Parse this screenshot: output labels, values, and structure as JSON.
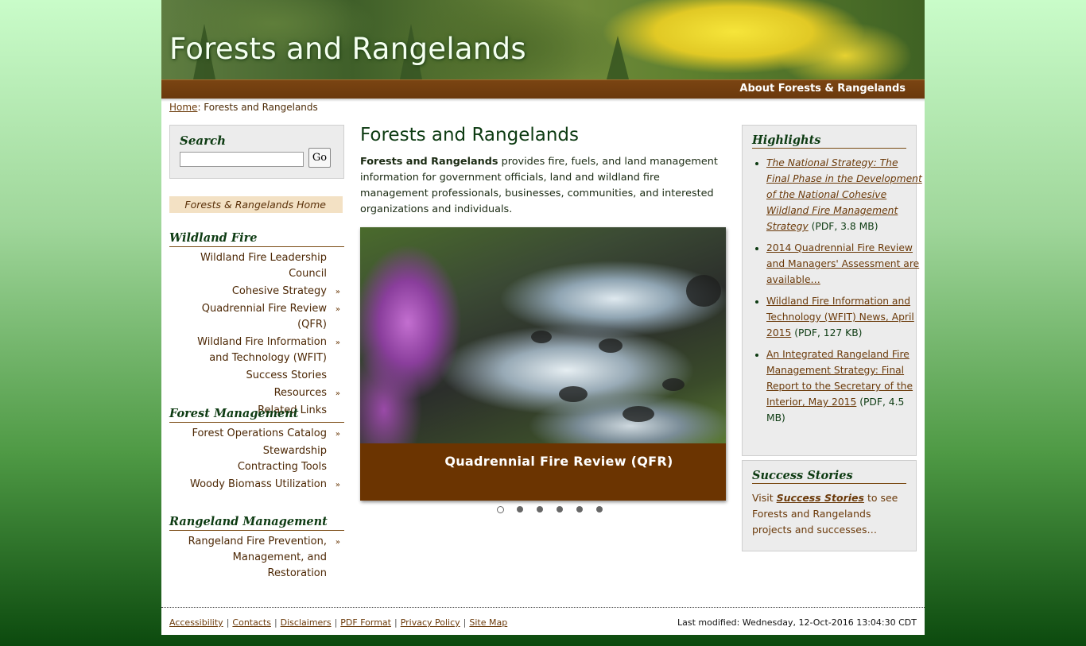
{
  "header": {
    "site_title": "Forests and Rangelands",
    "about_link": "About Forests & Rangelands"
  },
  "breadcrumb": {
    "home": "Home",
    "separator": ": ",
    "current": "Forests and Rangelands"
  },
  "search": {
    "heading": "Search",
    "placeholder": "",
    "value": "",
    "button": "Go"
  },
  "left_nav": {
    "home_link": "Forests & Rangelands Home",
    "sections": [
      {
        "title": "Wildland Fire",
        "items": [
          {
            "label": "Wildland Fire Leadership Council",
            "has_submenu": false
          },
          {
            "label": "Cohesive Strategy",
            "has_submenu": true
          },
          {
            "label": "Quadrennial Fire Review (QFR)",
            "has_submenu": true
          },
          {
            "label": "Wildland Fire Information and Technology (WFIT)",
            "has_submenu": true
          },
          {
            "label": "Success Stories",
            "has_submenu": false
          },
          {
            "label": "Resources",
            "has_submenu": true
          },
          {
            "label": "Related Links",
            "has_submenu": false
          }
        ]
      },
      {
        "title": "Forest Management",
        "items": [
          {
            "label": "Forest Operations Catalog",
            "has_submenu": true
          },
          {
            "label": "Stewardship Contracting Tools",
            "has_submenu": false
          },
          {
            "label": "Woody Biomass Utilization",
            "has_submenu": true
          }
        ]
      },
      {
        "title": "Rangeland Management",
        "items": [
          {
            "label": "Rangeland Fire Prevention, Management, and Restoration",
            "has_submenu": true
          }
        ]
      }
    ],
    "arrow_glyph": "»"
  },
  "main": {
    "title": "Forests and Rangelands",
    "intro_bold": "Forests and Rangelands",
    "intro_rest": " provides fire, fuels, and land management information for government officials, land and wildland fire management professionals, businesses, communities, and interested organizations and individuals.",
    "slideshow": {
      "caption": "Quadrennial Fire Review (QFR)",
      "total_slides": 6,
      "active_slide": 1
    }
  },
  "highlights": {
    "title": "Highlights",
    "items": [
      {
        "link": "The National Strategy: The Final Phase in the Development of the National Cohesive Wildland Fire Management Strategy",
        "italic": true,
        "suffix": " (PDF, 3.8 MB)"
      },
      {
        "link": "2014 Quadrennial Fire Review and Managers' Assessment are available…",
        "italic": false,
        "suffix": ""
      },
      {
        "link": "Wildland Fire Information and Technology (WFIT) News, April 2015",
        "italic": false,
        "suffix": " (PDF, 127 KB)"
      },
      {
        "link": "An Integrated Rangeland Fire Management Strategy: Final Report to the Secretary of the Interior, May 2015",
        "italic": false,
        "suffix": " (PDF, 4.5 MB)"
      }
    ]
  },
  "success_stories": {
    "title": "Success Stories",
    "text_pre": "Visit ",
    "text_link": "Success Stories",
    "text_post": " to see Forests and Rangelands projects and successes…"
  },
  "footer": {
    "links": [
      "Accessibility",
      "Contacts",
      "Disclaimers",
      "PDF Format",
      "Privacy Policy",
      "Site Map"
    ],
    "separator": "|",
    "last_modified": "Last modified: Wednesday, 12-Oct-2016 13:04:30 CDT"
  },
  "colors": {
    "brand_brown": "#6b3401",
    "heading_green": "#0d3b12",
    "link_brown": "#6b3a0a"
  }
}
